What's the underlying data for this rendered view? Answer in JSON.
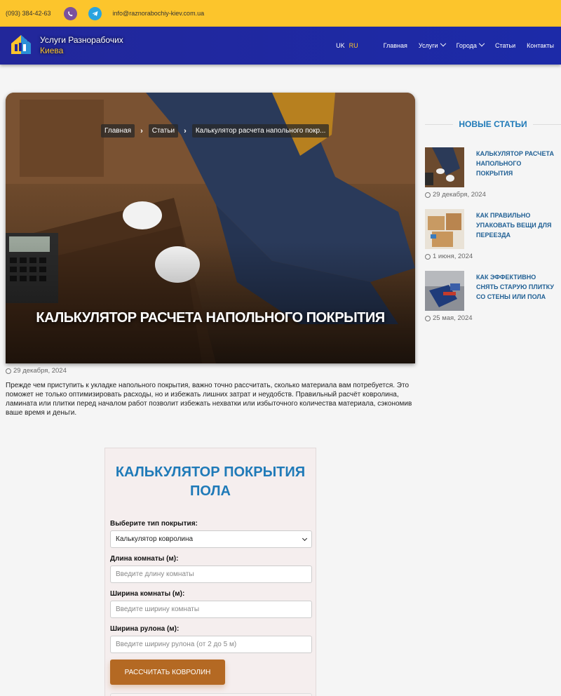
{
  "topbar": {
    "phone": "(093) 384-42-63",
    "email": "info@raznorabochiy-kiev.com.ua",
    "viber_icon": "viber-icon",
    "telegram_icon": "telegram-icon"
  },
  "header": {
    "brand_line1": "Услуги Разнорабочих",
    "brand_line2": "Киева",
    "lang_uk": "UK",
    "lang_ru": "RU",
    "nav": [
      "Главная",
      "Услуги",
      "Города",
      "Статьи",
      "Контакты"
    ]
  },
  "hero": {
    "breadcrumbs": [
      "Главная",
      "Статьи",
      "Калькулятор расчета напольного покр..."
    ],
    "title": "КАЛЬКУЛЯТОР РАСЧЕТА НАПОЛЬНОГО ПОКРЫТИЯ"
  },
  "article": {
    "date": "29 декабря, 2024",
    "intro": "Прежде чем приступить к укладке напольного покрытия, важно точно рассчитать, сколько материала вам потребуется. Это поможет не только оптимизировать расходы, но и избежать лишних затрат и неудобств. Правильный расчёт ковролина, ламината или плитки перед началом работ позволит избежать нехватки или избыточного количества материала, сэкономив ваше время и деньги."
  },
  "calculator": {
    "title": "КАЛЬКУЛЯТОР ПОКРЫТИЯ ПОЛА",
    "type_label": "Выберите тип покрытия:",
    "type_value": "Калькулятор ковролина",
    "length_label": "Длина комнаты (м):",
    "length_placeholder": "Введите длину комнаты",
    "width_label": "Ширина комнаты (м):",
    "width_placeholder": "Введите ширину комнаты",
    "roll_label": "Ширина рулона (м):",
    "roll_placeholder": "Введите ширину рулона (от 2 до 5 м)",
    "button": "РАССЧИТАТЬ КОВРОЛИН"
  },
  "sidebar": {
    "heading": "НОВЫЕ СТАТЬИ",
    "posts": [
      {
        "title": "КАЛЬКУЛЯТОР РАСЧЕТА НАПОЛЬНОГО ПОКРЫТИЯ",
        "date": "29 декабря, 2024"
      },
      {
        "title": "КАК ПРАВИЛЬНО УПАКОВАТЬ ВЕЩИ ДЛЯ ПЕРЕЕЗДА",
        "date": "1 июня, 2024"
      },
      {
        "title": "КАК ЭФФЕКТИВНО СНЯТЬ СТАРУЮ ПЛИТКУ СО СТЕНЫ ИЛИ ПОЛА",
        "date": "25 мая, 2024"
      }
    ]
  },
  "colors": {
    "topbar": "#fcc52c",
    "header": "#22279a",
    "accent_blue": "#1f7ab8",
    "button": "#b46923"
  }
}
